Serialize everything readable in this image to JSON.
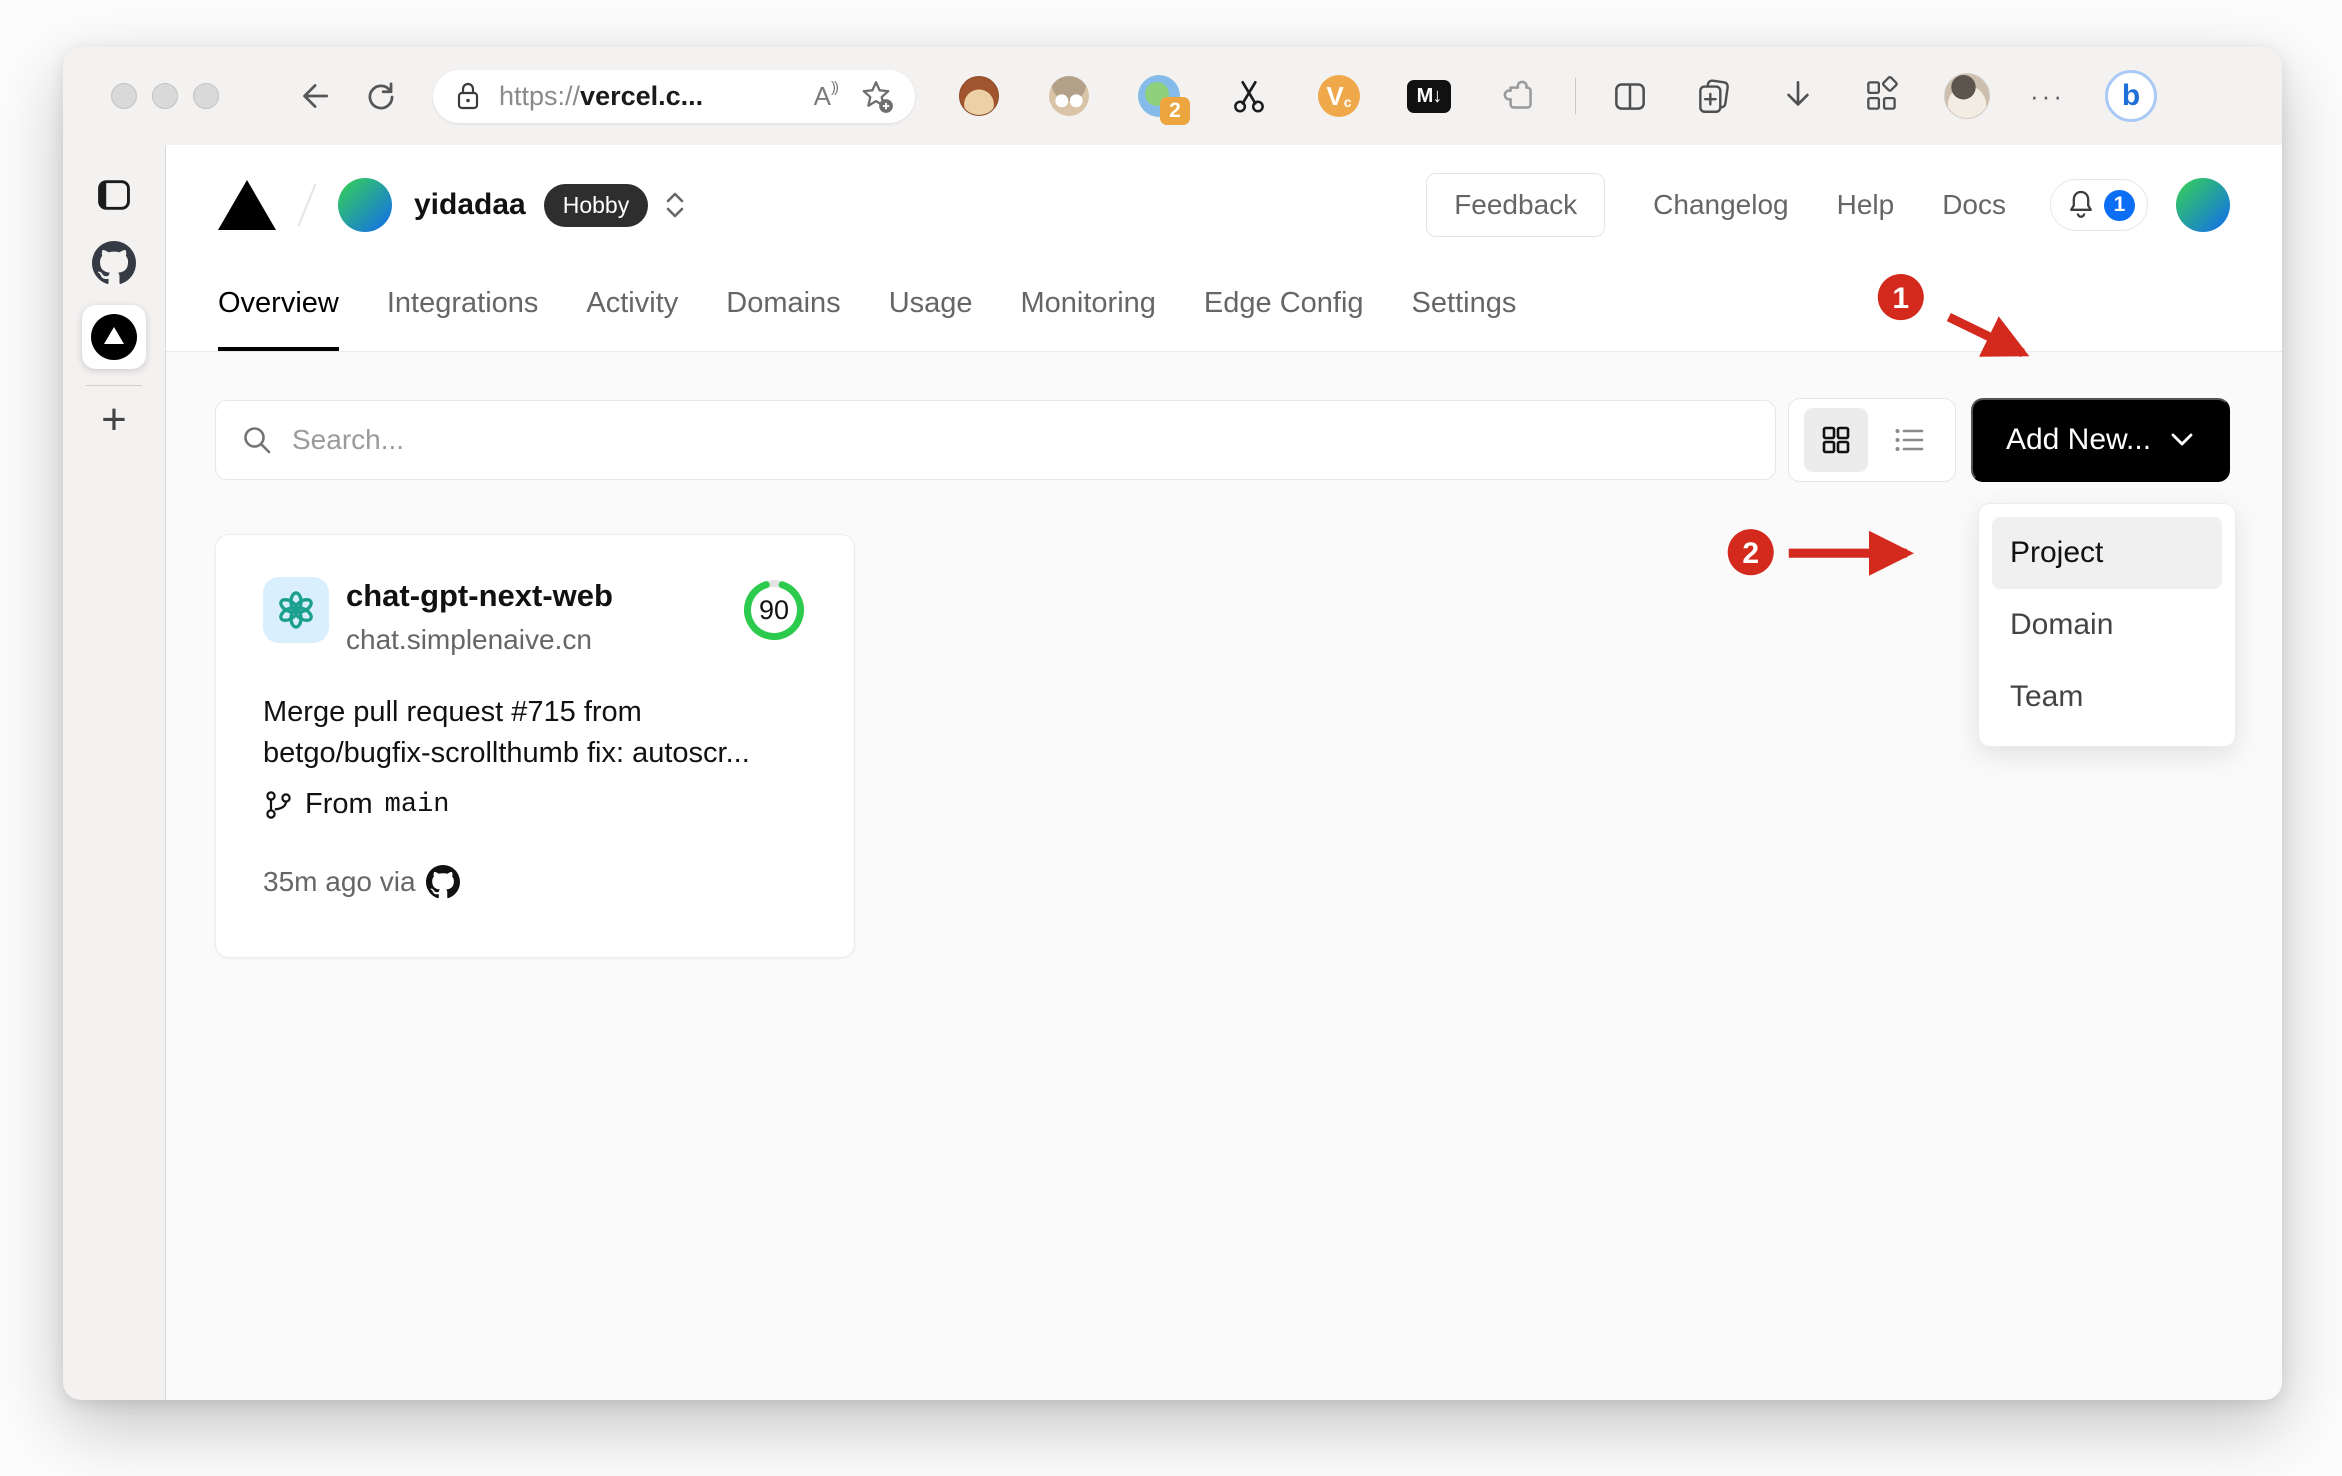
{
  "browser": {
    "url": {
      "scheme": "https://",
      "host": "vercel.c..."
    },
    "reader_label": "A",
    "extensions": {
      "badge_count": "2",
      "vc_letter": "V",
      "vc_sub": "c",
      "markdown_label": "M↓"
    },
    "more_label": "···",
    "bing_letter": "b"
  },
  "edge_sidebar": {
    "plus": "+"
  },
  "vercel": {
    "header": {
      "team": "yidadaa",
      "plan": "Hobby",
      "feedback": "Feedback",
      "links": [
        "Changelog",
        "Help",
        "Docs"
      ],
      "bell_count": "1"
    },
    "tabs": [
      "Overview",
      "Integrations",
      "Activity",
      "Domains",
      "Usage",
      "Monitoring",
      "Edge Config",
      "Settings"
    ],
    "controls": {
      "search_placeholder": "Search...",
      "add_new": "Add New..."
    },
    "dropdown": {
      "items": [
        "Project",
        "Domain",
        "Team"
      ]
    },
    "card": {
      "title": "chat-gpt-next-web",
      "domain": "chat.simplenaive.cn",
      "score": "90",
      "commit_lines": [
        "Merge pull request #715 from",
        "betgo/bugfix-scrollthumb fix: autoscr..."
      ],
      "from_label": "From",
      "branch": "main",
      "time": "35m ago via"
    },
    "colors": {
      "score_ring": "#2ccb4e",
      "bell_badge": "#0b6ef5"
    }
  },
  "annotations": {
    "step_1": "1",
    "step_2": "2",
    "color": "#d42a1e"
  }
}
